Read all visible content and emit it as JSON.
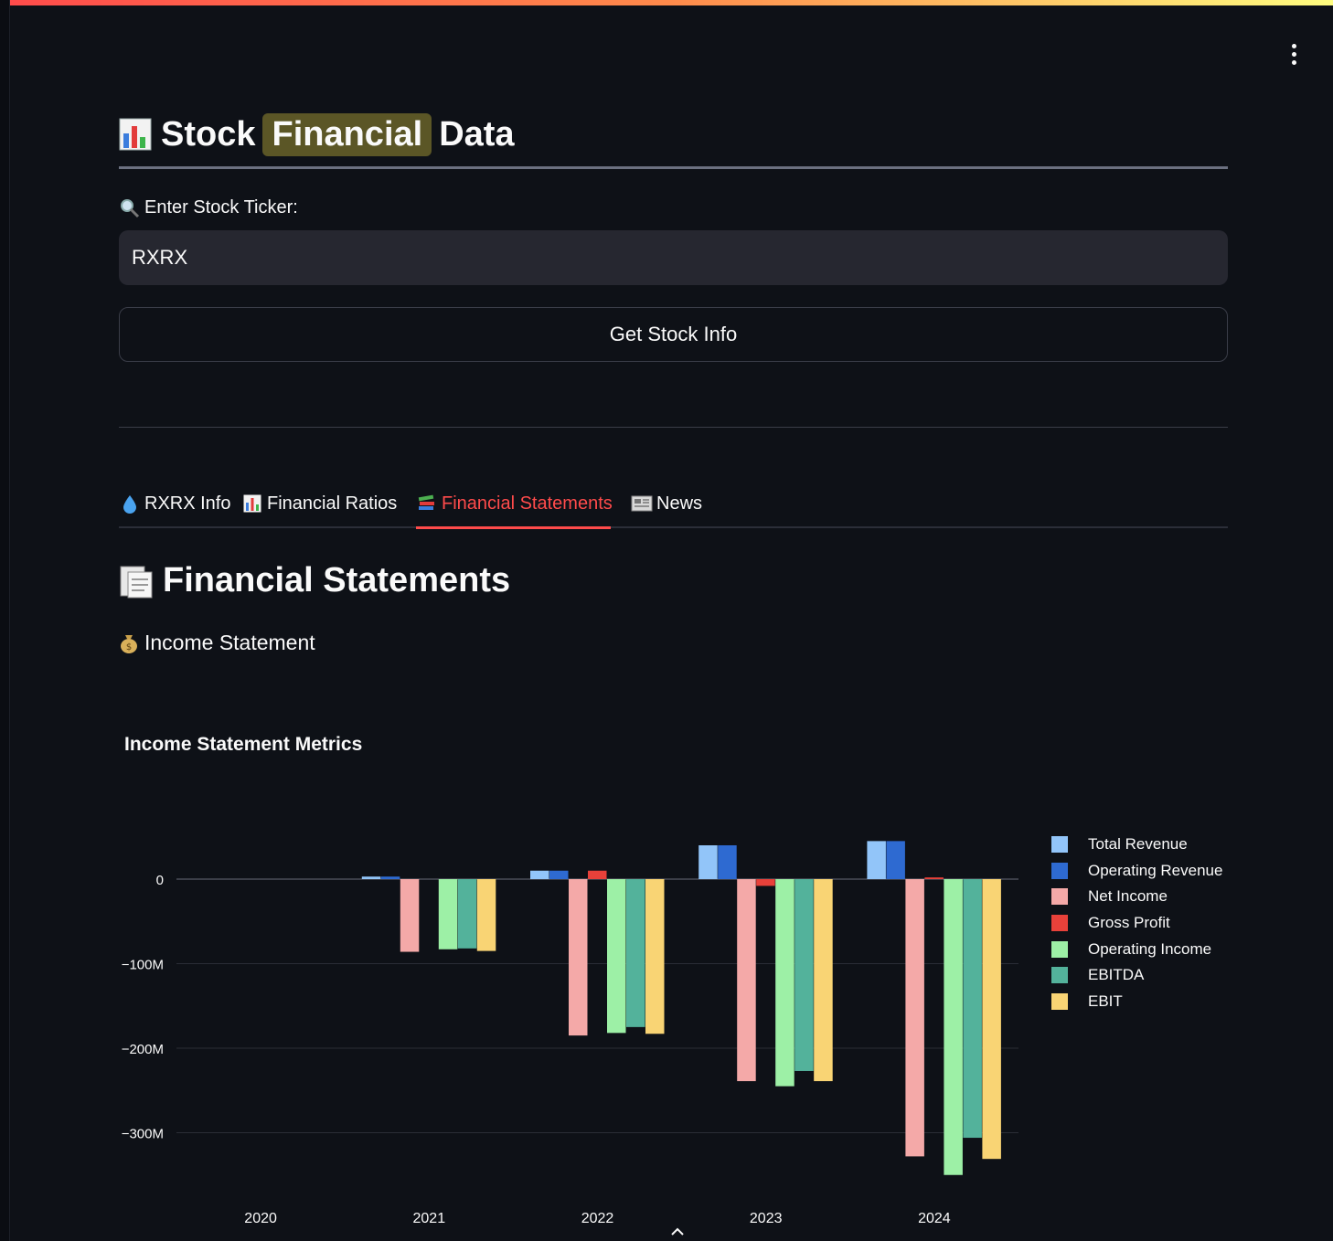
{
  "app": {
    "title_part1": "Stock",
    "title_highlight": "Financial",
    "title_part3": "Data",
    "ticker_label": "Enter Stock Ticker:",
    "ticker_value": "RXRX",
    "button_label": "Get Stock Info"
  },
  "tabs": [
    {
      "label": "RXRX Info",
      "icon": "droplet-icon",
      "active": false
    },
    {
      "label": "Financial Ratios",
      "icon": "bar-chart-icon",
      "active": false
    },
    {
      "label": "Financial Statements",
      "icon": "books-icon",
      "active": true
    },
    {
      "label": "News",
      "icon": "newspaper-icon",
      "active": false
    }
  ],
  "section": {
    "title": "Financial Statements",
    "subtitle": "Income Statement"
  },
  "colors": {
    "accent": "#ff4b4b",
    "background": "#0e1117",
    "highlight": "#5b5626"
  },
  "chart_data": {
    "type": "bar",
    "title": "Income Statement Metrics",
    "xlabel": "",
    "ylabel": "",
    "categories": [
      "2020",
      "2021",
      "2022",
      "2023",
      "2024"
    ],
    "ylim": [
      -360,
      60
    ],
    "yticks": [
      0,
      -100,
      -200,
      -300
    ],
    "ytick_labels": [
      "0",
      "−100M",
      "−200M",
      "−300M"
    ],
    "grid": true,
    "legend_position": "right",
    "series": [
      {
        "name": "Total Revenue",
        "color": "#92c5f9",
        "values": [
          null,
          3,
          10,
          40,
          45
        ]
      },
      {
        "name": "Operating Revenue",
        "color": "#2e6ad1",
        "values": [
          null,
          3,
          10,
          40,
          45
        ]
      },
      {
        "name": "Net Income",
        "color": "#f4a9a8",
        "values": [
          null,
          -86,
          -185,
          -239,
          -328
        ]
      },
      {
        "name": "Gross Profit",
        "color": "#e8413a",
        "values": [
          null,
          null,
          10,
          -8,
          2
        ]
      },
      {
        "name": "Operating Income",
        "color": "#9df0a6",
        "values": [
          null,
          -83,
          -182,
          -245,
          -350
        ]
      },
      {
        "name": "EBITDA",
        "color": "#53b29b",
        "values": [
          null,
          -82,
          -175,
          -227,
          -306
        ]
      },
      {
        "name": "EBIT",
        "color": "#f9d474",
        "values": [
          null,
          -85,
          -183,
          -239,
          -331
        ]
      }
    ]
  }
}
